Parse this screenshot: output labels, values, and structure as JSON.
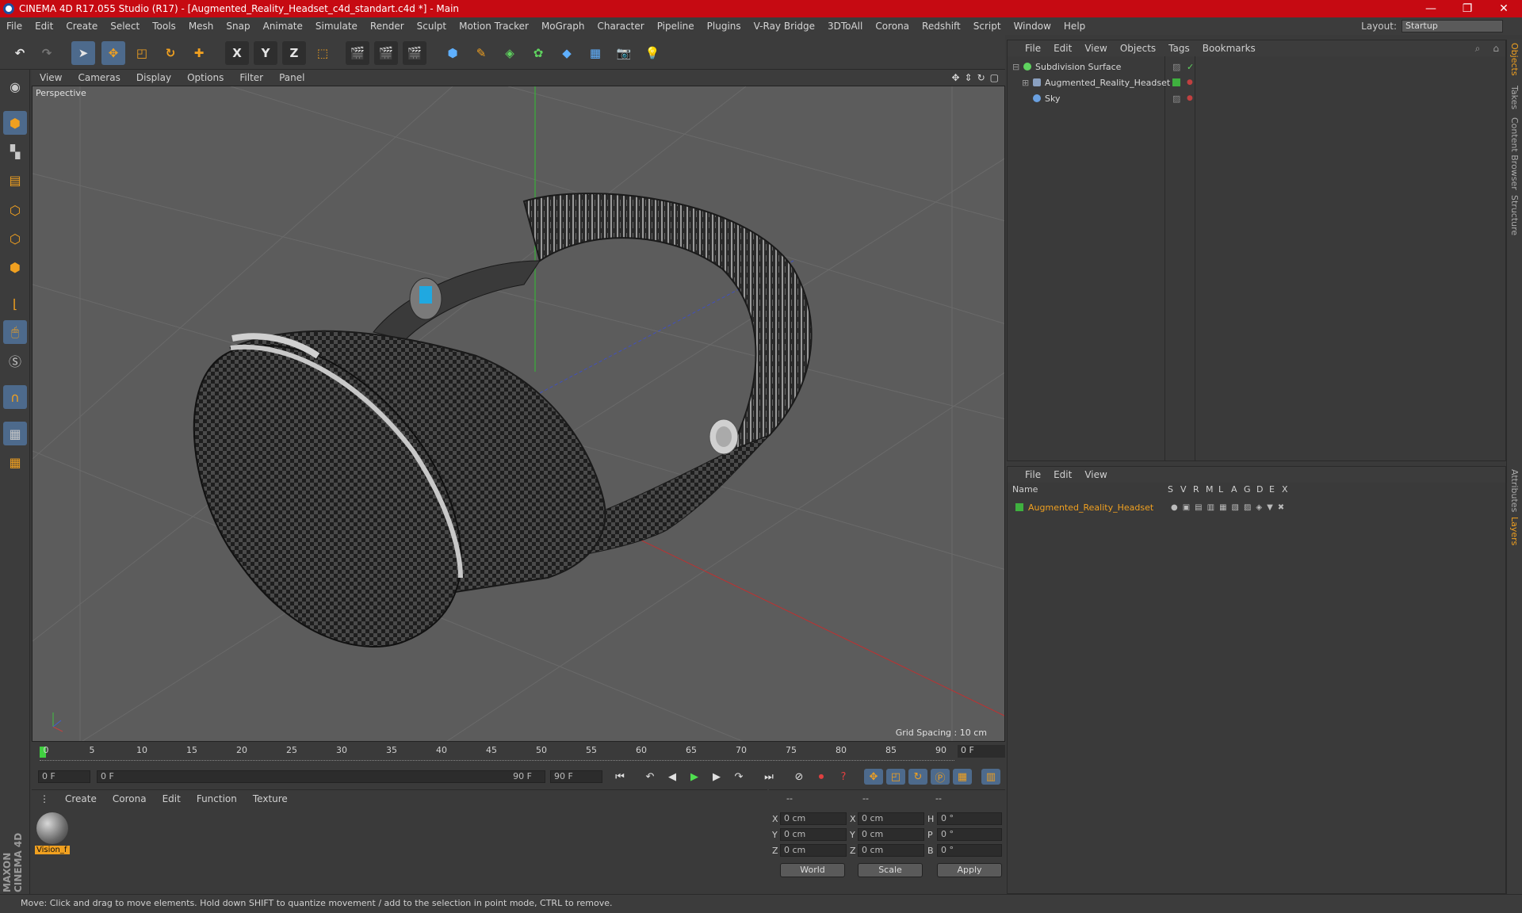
{
  "window": {
    "title": "CINEMA 4D R17.055 Studio (R17) - [Augmented_Reality_Headset_c4d_standart.c4d *] - Main",
    "minimize": "—",
    "restore": "❐",
    "close": "✕"
  },
  "menu": {
    "items": [
      "File",
      "Edit",
      "Create",
      "Select",
      "Tools",
      "Mesh",
      "Snap",
      "Animate",
      "Simulate",
      "Render",
      "Sculpt",
      "Motion Tracker",
      "MoGraph",
      "Character",
      "Pipeline",
      "Plugins",
      "V-Ray Bridge",
      "3DToAll",
      "Corona",
      "Redshift",
      "Script",
      "Window",
      "Help"
    ],
    "layout_label": "Layout:",
    "layout_value": "Startup"
  },
  "toolbar": {
    "x_label": "X",
    "y_label": "Y",
    "z_label": "Z"
  },
  "viewport": {
    "menu": [
      "View",
      "Cameras",
      "Display",
      "Options",
      "Filter",
      "Panel"
    ],
    "camera": "Perspective",
    "grid_spacing": "Grid Spacing : 10 cm"
  },
  "timeline": {
    "ticks": [
      "0",
      "5",
      "10",
      "15",
      "20",
      "25",
      "30",
      "35",
      "40",
      "45",
      "50",
      "55",
      "60",
      "65",
      "70",
      "75",
      "80",
      "85",
      "90"
    ],
    "current_frame": "0 F"
  },
  "transport": {
    "start_field": "0 F",
    "range_start": "0 F",
    "range_end": "90 F",
    "end_field": "90 F"
  },
  "materials": {
    "menu": [
      "Create",
      "Corona",
      "Edit",
      "Function",
      "Texture"
    ],
    "items": [
      {
        "name": "Vision_f"
      }
    ]
  },
  "coords": {
    "header": [
      "--",
      "--",
      "--"
    ],
    "rows": [
      {
        "a": "X",
        "av": "0 cm",
        "b": "X",
        "bv": "0 cm",
        "c": "H",
        "cv": "0 °"
      },
      {
        "a": "Y",
        "av": "0 cm",
        "b": "Y",
        "bv": "0 cm",
        "c": "P",
        "cv": "0 °"
      },
      {
        "a": "Z",
        "av": "0 cm",
        "b": "Z",
        "bv": "0 cm",
        "c": "B",
        "cv": "0 °"
      }
    ],
    "world": "World",
    "scale": "Scale",
    "apply": "Apply"
  },
  "object_manager": {
    "menu": [
      "File",
      "Edit",
      "View",
      "Objects",
      "Tags",
      "Bookmarks"
    ],
    "objects": [
      {
        "name": "Subdivision Surface",
        "color": "#5fd35f"
      },
      {
        "name": "Augmented_Reality_Headset",
        "color": "#3fb03f"
      },
      {
        "name": "Sky",
        "color": "#6aa0e0"
      }
    ]
  },
  "layer_manager": {
    "menu": [
      "File",
      "Edit",
      "View"
    ],
    "columns": [
      "Name",
      "S",
      "V",
      "R",
      "M",
      "L",
      "A",
      "G",
      "D",
      "E",
      "X"
    ],
    "layers": [
      {
        "name": "Augmented_Reality_Headset",
        "color": "#3fb03f"
      }
    ]
  },
  "side_tabs": [
    "Objects",
    "Takes",
    "Content Browser",
    "Structure"
  ],
  "side_tabs_lower": [
    "Attributes",
    "Layers"
  ],
  "brand": "MAXON CINEMA 4D",
  "status": "Move: Click and drag to move elements. Hold down SHIFT to quantize movement / add to the selection in point mode, CTRL to remove.",
  "colors": {
    "titlebar": "#c60a12",
    "accent": "#f0a020",
    "selection": "#4d6a8c"
  }
}
